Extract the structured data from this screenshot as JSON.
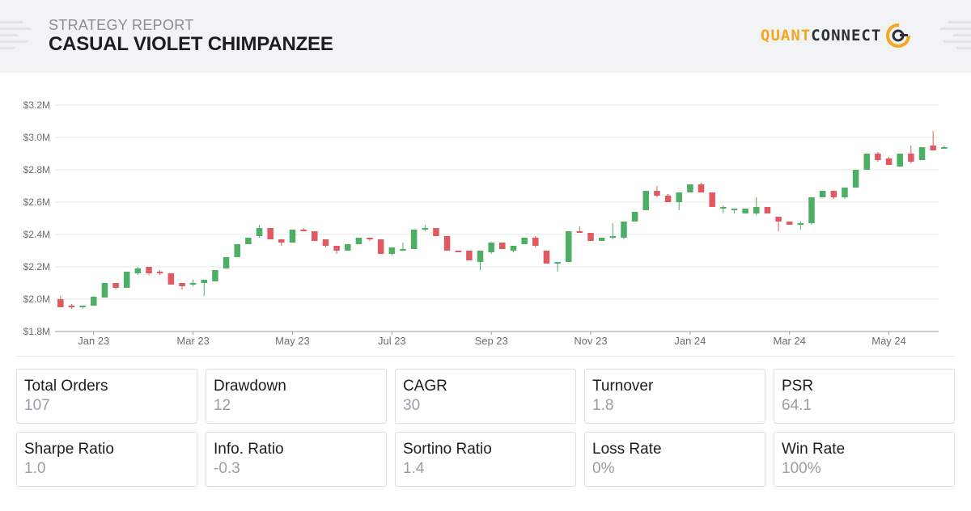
{
  "header": {
    "kicker": "STRATEGY REPORT",
    "title": "CASUAL VIOLET CHIMPANZEE",
    "brand_left": "QUANT",
    "brand_right": "CONNECT"
  },
  "colors": {
    "up": "#4caf63",
    "down": "#e05a5f",
    "brand_orange": "#f5a623",
    "grid": "#e6e7ea",
    "axis_text": "#6b6e74"
  },
  "chart_data": {
    "type": "candlestick",
    "title": "",
    "xlabel": "",
    "ylabel": "",
    "ylim": [
      1.8,
      3.2
    ],
    "y_ticks": [
      {
        "value": 1.8,
        "label": "$1.8M"
      },
      {
        "value": 2.0,
        "label": "$2.0M"
      },
      {
        "value": 2.2,
        "label": "$2.2M"
      },
      {
        "value": 2.4,
        "label": "$2.4M"
      },
      {
        "value": 2.6,
        "label": "$2.6M"
      },
      {
        "value": 2.8,
        "label": "$2.8M"
      },
      {
        "value": 3.0,
        "label": "$3.0M"
      },
      {
        "value": 3.2,
        "label": "$3.2M"
      }
    ],
    "x_ticks": [
      {
        "week": 3,
        "label": "Jan 23"
      },
      {
        "week": 12,
        "label": "Mar 23"
      },
      {
        "week": 21,
        "label": "May 23"
      },
      {
        "week": 30,
        "label": "Jul 23"
      },
      {
        "week": 39,
        "label": "Sep 23"
      },
      {
        "week": 48,
        "label": "Nov 23"
      },
      {
        "week": 57,
        "label": "Jan 24"
      },
      {
        "week": 66,
        "label": "Mar 24"
      },
      {
        "week": 75,
        "label": "May 24"
      }
    ],
    "x_count": 80,
    "grid": true,
    "candles": [
      {
        "o": 2.0,
        "h": 2.02,
        "l": 1.95,
        "c": 1.95
      },
      {
        "o": 1.96,
        "h": 1.97,
        "l": 1.94,
        "c": 1.955
      },
      {
        "o": 1.95,
        "h": 1.96,
        "l": 1.94,
        "c": 1.96
      },
      {
        "o": 1.96,
        "h": 2.02,
        "l": 1.96,
        "c": 2.015
      },
      {
        "o": 2.01,
        "h": 2.1,
        "l": 2.01,
        "c": 2.1
      },
      {
        "o": 2.1,
        "h": 2.1,
        "l": 2.06,
        "c": 2.07
      },
      {
        "o": 2.07,
        "h": 2.17,
        "l": 2.07,
        "c": 2.17
      },
      {
        "o": 2.16,
        "h": 2.2,
        "l": 2.15,
        "c": 2.19
      },
      {
        "o": 2.2,
        "h": 2.2,
        "l": 2.15,
        "c": 2.16
      },
      {
        "o": 2.17,
        "h": 2.18,
        "l": 2.15,
        "c": 2.16
      },
      {
        "o": 2.16,
        "h": 2.16,
        "l": 2.09,
        "c": 2.09
      },
      {
        "o": 2.1,
        "h": 2.1,
        "l": 2.06,
        "c": 2.08
      },
      {
        "o": 2.09,
        "h": 2.12,
        "l": 2.08,
        "c": 2.1
      },
      {
        "o": 2.1,
        "h": 2.12,
        "l": 2.02,
        "c": 2.12
      },
      {
        "o": 2.11,
        "h": 2.18,
        "l": 2.11,
        "c": 2.18
      },
      {
        "o": 2.19,
        "h": 2.26,
        "l": 2.19,
        "c": 2.26
      },
      {
        "o": 2.26,
        "h": 2.34,
        "l": 2.26,
        "c": 2.34
      },
      {
        "o": 2.34,
        "h": 2.38,
        "l": 2.34,
        "c": 2.38
      },
      {
        "o": 2.39,
        "h": 2.46,
        "l": 2.38,
        "c": 2.44
      },
      {
        "o": 2.44,
        "h": 2.44,
        "l": 2.37,
        "c": 2.37
      },
      {
        "o": 2.37,
        "h": 2.37,
        "l": 2.33,
        "c": 2.35
      },
      {
        "o": 2.35,
        "h": 2.43,
        "l": 2.35,
        "c": 2.43
      },
      {
        "o": 2.43,
        "h": 2.44,
        "l": 2.42,
        "c": 2.42
      },
      {
        "o": 2.42,
        "h": 2.42,
        "l": 2.36,
        "c": 2.36
      },
      {
        "o": 2.37,
        "h": 2.37,
        "l": 2.32,
        "c": 2.33
      },
      {
        "o": 2.33,
        "h": 2.33,
        "l": 2.28,
        "c": 2.3
      },
      {
        "o": 2.3,
        "h": 2.34,
        "l": 2.3,
        "c": 2.34
      },
      {
        "o": 2.34,
        "h": 2.38,
        "l": 2.34,
        "c": 2.38
      },
      {
        "o": 2.38,
        "h": 2.38,
        "l": 2.36,
        "c": 2.37
      },
      {
        "o": 2.37,
        "h": 2.37,
        "l": 2.28,
        "c": 2.28
      },
      {
        "o": 2.28,
        "h": 2.32,
        "l": 2.27,
        "c": 2.32
      },
      {
        "o": 2.31,
        "h": 2.35,
        "l": 2.3,
        "c": 2.31
      },
      {
        "o": 2.31,
        "h": 2.43,
        "l": 2.31,
        "c": 2.43
      },
      {
        "o": 2.43,
        "h": 2.46,
        "l": 2.42,
        "c": 2.44
      },
      {
        "o": 2.44,
        "h": 2.44,
        "l": 2.39,
        "c": 2.39
      },
      {
        "o": 2.39,
        "h": 2.39,
        "l": 2.3,
        "c": 2.3
      },
      {
        "o": 2.3,
        "h": 2.3,
        "l": 2.29,
        "c": 2.295
      },
      {
        "o": 2.3,
        "h": 2.3,
        "l": 2.24,
        "c": 2.24
      },
      {
        "o": 2.23,
        "h": 2.3,
        "l": 2.18,
        "c": 2.3
      },
      {
        "o": 2.29,
        "h": 2.35,
        "l": 2.28,
        "c": 2.35
      },
      {
        "o": 2.35,
        "h": 2.35,
        "l": 2.31,
        "c": 2.31
      },
      {
        "o": 2.3,
        "h": 2.33,
        "l": 2.29,
        "c": 2.33
      },
      {
        "o": 2.34,
        "h": 2.38,
        "l": 2.34,
        "c": 2.38
      },
      {
        "o": 2.38,
        "h": 2.39,
        "l": 2.32,
        "c": 2.33
      },
      {
        "o": 2.3,
        "h": 2.3,
        "l": 2.22,
        "c": 2.22
      },
      {
        "o": 2.22,
        "h": 2.23,
        "l": 2.17,
        "c": 2.23
      },
      {
        "o": 2.23,
        "h": 2.42,
        "l": 2.23,
        "c": 2.42
      },
      {
        "o": 2.42,
        "h": 2.45,
        "l": 2.41,
        "c": 2.41
      },
      {
        "o": 2.41,
        "h": 2.41,
        "l": 2.36,
        "c": 2.36
      },
      {
        "o": 2.36,
        "h": 2.38,
        "l": 2.36,
        "c": 2.38
      },
      {
        "o": 2.38,
        "h": 2.47,
        "l": 2.37,
        "c": 2.39
      },
      {
        "o": 2.38,
        "h": 2.48,
        "l": 2.37,
        "c": 2.48
      },
      {
        "o": 2.48,
        "h": 2.54,
        "l": 2.48,
        "c": 2.54
      },
      {
        "o": 2.55,
        "h": 2.67,
        "l": 2.55,
        "c": 2.67
      },
      {
        "o": 2.67,
        "h": 2.7,
        "l": 2.63,
        "c": 2.64
      },
      {
        "o": 2.64,
        "h": 2.65,
        "l": 2.6,
        "c": 2.6
      },
      {
        "o": 2.6,
        "h": 2.66,
        "l": 2.55,
        "c": 2.66
      },
      {
        "o": 2.66,
        "h": 2.71,
        "l": 2.66,
        "c": 2.71
      },
      {
        "o": 2.71,
        "h": 2.72,
        "l": 2.66,
        "c": 2.66
      },
      {
        "o": 2.66,
        "h": 2.66,
        "l": 2.57,
        "c": 2.57
      },
      {
        "o": 2.56,
        "h": 2.58,
        "l": 2.53,
        "c": 2.57
      },
      {
        "o": 2.56,
        "h": 2.56,
        "l": 2.53,
        "c": 2.56
      },
      {
        "o": 2.53,
        "h": 2.56,
        "l": 2.53,
        "c": 2.56
      },
      {
        "o": 2.53,
        "h": 2.63,
        "l": 2.52,
        "c": 2.57
      },
      {
        "o": 2.57,
        "h": 2.57,
        "l": 2.53,
        "c": 2.53
      },
      {
        "o": 2.51,
        "h": 2.51,
        "l": 2.42,
        "c": 2.48
      },
      {
        "o": 2.48,
        "h": 2.48,
        "l": 2.46,
        "c": 2.46
      },
      {
        "o": 2.46,
        "h": 2.48,
        "l": 2.43,
        "c": 2.47
      },
      {
        "o": 2.47,
        "h": 2.62,
        "l": 2.46,
        "c": 2.63
      },
      {
        "o": 2.63,
        "h": 2.67,
        "l": 2.63,
        "c": 2.67
      },
      {
        "o": 2.67,
        "h": 2.67,
        "l": 2.62,
        "c": 2.63
      },
      {
        "o": 2.63,
        "h": 2.69,
        "l": 2.62,
        "c": 2.69
      },
      {
        "o": 2.69,
        "h": 2.8,
        "l": 2.69,
        "c": 2.8
      },
      {
        "o": 2.8,
        "h": 2.9,
        "l": 2.8,
        "c": 2.9
      },
      {
        "o": 2.9,
        "h": 2.91,
        "l": 2.85,
        "c": 2.86
      },
      {
        "o": 2.87,
        "h": 2.88,
        "l": 2.83,
        "c": 2.83
      },
      {
        "o": 2.82,
        "h": 2.9,
        "l": 2.82,
        "c": 2.9
      },
      {
        "o": 2.9,
        "h": 2.95,
        "l": 2.84,
        "c": 2.85
      },
      {
        "o": 2.86,
        "h": 2.94,
        "l": 2.86,
        "c": 2.94
      },
      {
        "o": 2.95,
        "h": 3.04,
        "l": 2.93,
        "c": 2.92
      },
      {
        "o": 2.94,
        "h": 2.95,
        "l": 2.93,
        "c": 2.94
      }
    ]
  },
  "stats": [
    {
      "label": "Total Orders",
      "value": "107"
    },
    {
      "label": "Drawdown",
      "value": "12"
    },
    {
      "label": "CAGR",
      "value": "30"
    },
    {
      "label": "Turnover",
      "value": "1.8"
    },
    {
      "label": "PSR",
      "value": "64.1"
    },
    {
      "label": "Sharpe Ratio",
      "value": "1.0"
    },
    {
      "label": "Info. Ratio",
      "value": "-0.3"
    },
    {
      "label": "Sortino Ratio",
      "value": "1.4"
    },
    {
      "label": "Loss Rate",
      "value": "0%"
    },
    {
      "label": "Win Rate",
      "value": "100%"
    }
  ]
}
